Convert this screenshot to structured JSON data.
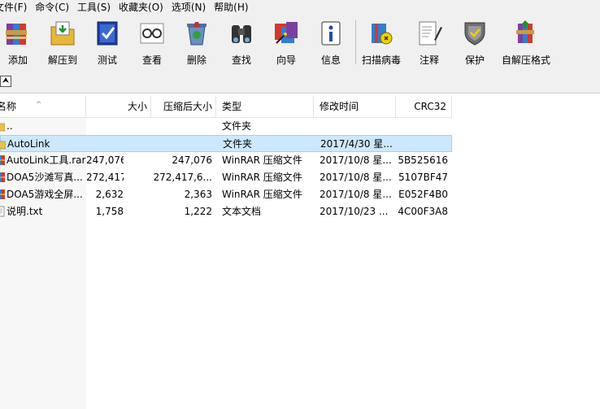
{
  "menu": [
    {
      "label": "文件(F)"
    },
    {
      "label": "命令(C)"
    },
    {
      "label": "工具(S)"
    },
    {
      "label": "收藏夹(O)"
    },
    {
      "label": "选项(N)"
    },
    {
      "label": "帮助(H)"
    }
  ],
  "toolbar": {
    "buttons": [
      {
        "label": "添加",
        "icon": "books-icon"
      },
      {
        "label": "解压到",
        "icon": "extract-folder-icon"
      },
      {
        "label": "测试",
        "icon": "test-check-icon"
      },
      {
        "label": "查看",
        "icon": "glasses-icon"
      },
      {
        "label": "删除",
        "icon": "recycle-bin-icon"
      },
      {
        "label": "查找",
        "icon": "binoculars-icon"
      },
      {
        "label": "向导",
        "icon": "wizard-icon"
      },
      {
        "label": "信息",
        "icon": "info-icon"
      },
      {
        "label": "扫描病毒",
        "icon": "virus-scan-icon"
      },
      {
        "label": "注释",
        "icon": "comment-pen-icon"
      },
      {
        "label": "保护",
        "icon": "shield-icon"
      },
      {
        "label": "自解压格式",
        "icon": "sfx-archive-icon"
      }
    ]
  },
  "pathbar": {
    "up_icon": "up-folder-icon",
    "up_glyph": "⮝"
  },
  "list": {
    "columns": [
      {
        "label": "名称"
      },
      {
        "label": "大小"
      },
      {
        "label": "压缩后大小"
      },
      {
        "label": "类型"
      },
      {
        "label": "修改时间"
      },
      {
        "label": "CRC32"
      }
    ],
    "sort_glyph": "^",
    "rows": [
      {
        "name": "..",
        "size": "",
        "packed": "",
        "type": "文件夹",
        "modified": "",
        "crc": "",
        "icon": "parent-folder-icon"
      },
      {
        "name": "AutoLink",
        "size": "",
        "packed": "",
        "type": "文件夹",
        "modified": "2017/4/30 星...",
        "crc": "",
        "icon": "folder-icon",
        "selected": true
      },
      {
        "name": "AutoLink工具.rar",
        "size": "247,076",
        "packed": "247,076",
        "type": "WinRAR 压缩文件",
        "modified": "2017/10/8 星...",
        "crc": "5B525616",
        "icon": "rar-archive-icon"
      },
      {
        "name": "DOA5沙滩写真...",
        "size": "272,417,6...",
        "packed": "272,417,6...",
        "type": "WinRAR 压缩文件",
        "modified": "2017/10/8 星...",
        "crc": "5107BF47",
        "icon": "rar-archive-icon"
      },
      {
        "name": "DOA5游戏全屏...",
        "size": "2,632",
        "packed": "2,363",
        "type": "WinRAR 压缩文件",
        "modified": "2017/10/8 星...",
        "crc": "E052F4B0",
        "icon": "rar-archive-icon"
      },
      {
        "name": "说明.txt",
        "size": "1,758",
        "packed": "1,222",
        "type": "文本文档",
        "modified": "2017/10/23 ...",
        "crc": "4C00F3A8",
        "icon": "text-file-icon"
      }
    ]
  }
}
